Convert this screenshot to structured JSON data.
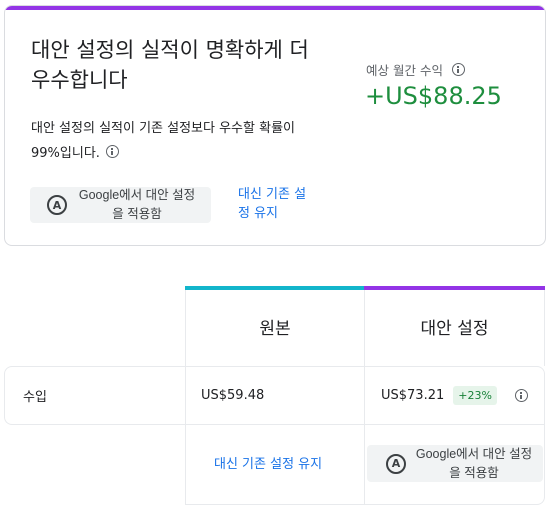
{
  "colors": {
    "accent_purple": "#9334e6",
    "accent_teal": "#12b5cb",
    "positive_green": "#1e8e3e",
    "link_blue": "#1a73e8"
  },
  "summary": {
    "headline": "대안 설정의 실적이 명확하게 더 우수합니다",
    "description": "대안 설정의 실적이 기존 설정보다 우수할 확률이 99%입니다.",
    "apply_button": "Google에서 대안 설정을 적용함",
    "keep_link": "대신 기존 설정 유지",
    "monthly_label": "예상 월간 수익",
    "monthly_value": "+US$88.25"
  },
  "table": {
    "columns": [
      "원본",
      "대안 설정"
    ],
    "row_label": "수입",
    "original_value": "US$59.48",
    "variant_value": "US$73.21",
    "variant_change": "+23%",
    "keep_link": "대신 기존 설정 유지",
    "apply_button": "Google에서 대안 설정을 적용함"
  },
  "icons": {
    "info": "info-icon",
    "apply": "auto-apply-icon",
    "apply_glyph": "A"
  }
}
